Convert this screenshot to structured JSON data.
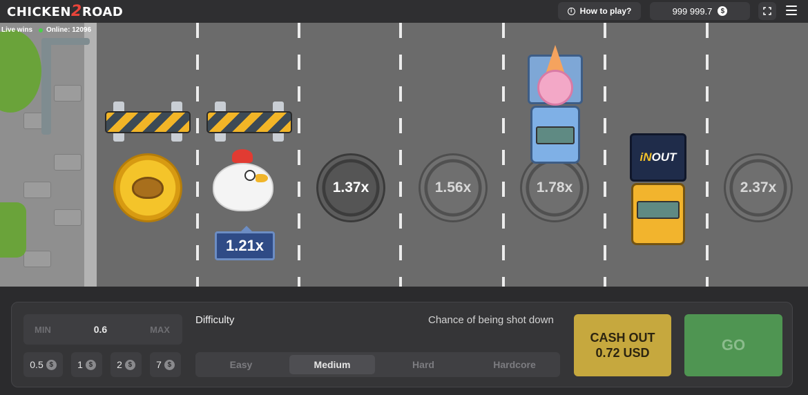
{
  "header": {
    "logo_text": "CHICKEN",
    "logo_number": "2",
    "logo_text_2": "ROAD",
    "how_to_play_label": "How to play?",
    "balance": "999 999.7",
    "currency_symbol": "$"
  },
  "road": {
    "live_wins_label": "Live wins",
    "online_label": "Online: 12096",
    "current_multiplier": "1.21x",
    "manholes": [
      "1.37x",
      "1.56x",
      "1.78x",
      "2.37x"
    ],
    "truck_brand_1": "iN",
    "truck_brand_2": "OUT"
  },
  "controls": {
    "min_label": "MIN",
    "bet_value": "0.6",
    "max_label": "MAX",
    "chips": [
      "0.5",
      "1",
      "2",
      "7"
    ],
    "chip_currency": "$",
    "difficulty_label": "Difficulty",
    "chance_label": "Chance of being shot down",
    "difficulties": [
      "Easy",
      "Medium",
      "Hard",
      "Hardcore"
    ],
    "active_difficulty": "Medium",
    "cashout_line1": "CASH OUT",
    "cashout_line2": "0.72 USD",
    "go_label": "GO"
  }
}
